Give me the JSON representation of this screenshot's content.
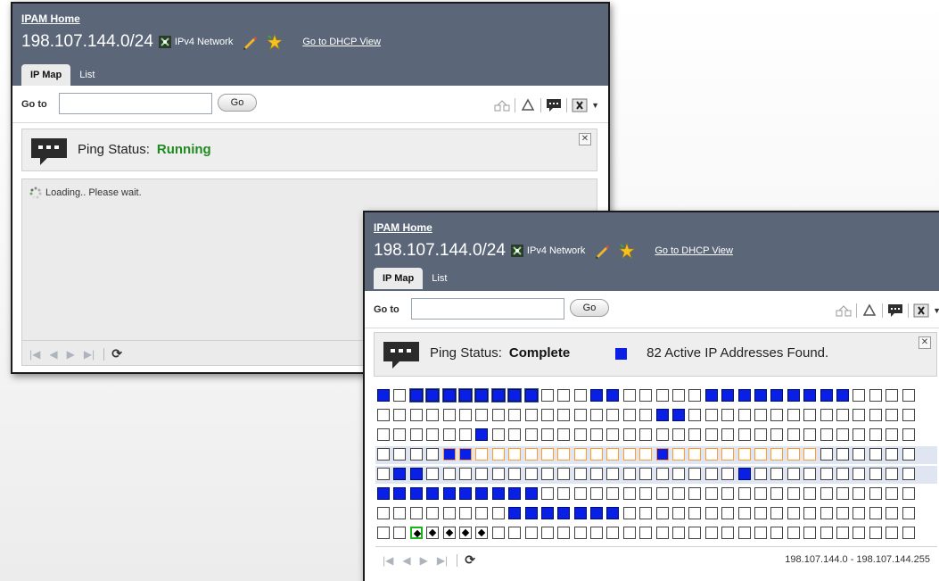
{
  "windows": [
    {
      "home_link": "IPAM Home",
      "network_title": "198.107.144.0/24",
      "network_type": "IPv4 Network",
      "dhcp_link": "Go to DHCP View",
      "tabs": [
        {
          "label": "IP Map",
          "active": true
        },
        {
          "label": "List",
          "active": false
        }
      ],
      "goto_label": "Go to",
      "goto_value": "",
      "go_button": "Go",
      "ping_status_label": "Ping Status:",
      "ping_status_value": "Running",
      "loading_text": "Loading.. Please wait.",
      "close_symbol": "✕"
    },
    {
      "home_link": "IPAM Home",
      "network_title": "198.107.144.0/24",
      "network_type": "IPv4 Network",
      "dhcp_link": "Go to DHCP View",
      "tabs": [
        {
          "label": "IP Map",
          "active": true
        },
        {
          "label": "List",
          "active": false
        }
      ],
      "goto_label": "Go to",
      "goto_value": "",
      "go_button": "Go",
      "ping_status_label": "Ping Status:",
      "ping_status_value": "Complete",
      "active_found_text": "82 Active IP Addresses Found.",
      "range_text": "198.107.144.0 - 198.107.144.255",
      "close_symbol": "✕"
    }
  ],
  "ip_map": {
    "rows": [
      "a_aaaaaaaa___aa_____aaaaaaaaa____",
      "_________________aa______________",
      "______a__________________________",
      "____aa___________a_______________",
      "_aa___________________a__________",
      "aaaaaaaaaa_______________________",
      "________aaaaaaa__________________",
      "_________________________________"
    ],
    "notes": "a = active address"
  },
  "colors": {
    "active": "#0a1fe6",
    "running": "#1f8a1f",
    "header_bg": "#5b6779"
  }
}
